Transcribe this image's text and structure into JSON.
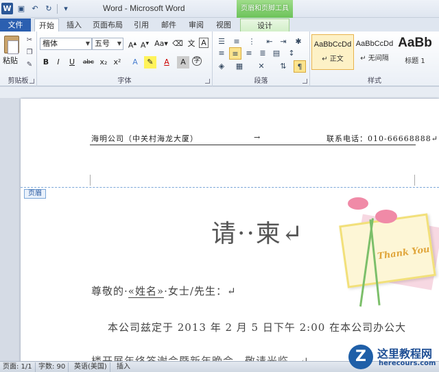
{
  "window": {
    "title": "Word - Microsoft Word",
    "context_tab_title": "页眉和页脚工具"
  },
  "qat": {
    "logo": "W",
    "undo": "↶",
    "redo": "↻",
    "more": "▾"
  },
  "tabs": {
    "file": "文件",
    "items": [
      "开始",
      "插入",
      "页面布局",
      "引用",
      "邮件",
      "审阅",
      "视图"
    ],
    "design": "设计"
  },
  "ribbon": {
    "clipboard": {
      "paste": "粘贴",
      "label": "剪贴板"
    },
    "font": {
      "name": "楷体",
      "size": "五号",
      "label": "字体",
      "buttons": [
        "B",
        "I",
        "U",
        "abc",
        "x₂",
        "x²",
        "A",
        "A",
        "Aa",
        "A",
        "A"
      ]
    },
    "paragraph": {
      "label": "段落"
    },
    "styles": {
      "label": "样式",
      "items": [
        {
          "sample": "AaBbCcDd",
          "name": "↵ 正文"
        },
        {
          "sample": "AaBbCcDd",
          "name": "↵ 无间隔"
        },
        {
          "sample": "AaBb",
          "name": "标题 1"
        }
      ]
    }
  },
  "document": {
    "header_left": "海明公司（中关村海龙大厦）",
    "header_tab": "→",
    "header_right": "联系电话：010-66668888↵",
    "header_tag": "页眉",
    "title": "请··柬↵",
    "greeting_pre": "尊敬的·",
    "greeting_field": "«姓名»",
    "greeting_post": "·女士/先生：↵",
    "body_line1": "本公司兹定于 2013 年 2 月 5 日下午 2:00 在本公司办公大",
    "body_line2": "楼开展年终答谢会暨新年晚会，敬请光临。↵",
    "card_text": "Thank You"
  },
  "status": {
    "page": "页面: 1/1",
    "words": "字数: 90",
    "lang": "英语(美国)",
    "mode": "插入"
  },
  "watermark": {
    "cn": "这里教程网",
    "en": "herecours.com",
    "logo": "Z"
  },
  "colors": {
    "file_tab": "#2b5fb0",
    "context": "#6cc35a",
    "accent": "#fbe48e"
  }
}
